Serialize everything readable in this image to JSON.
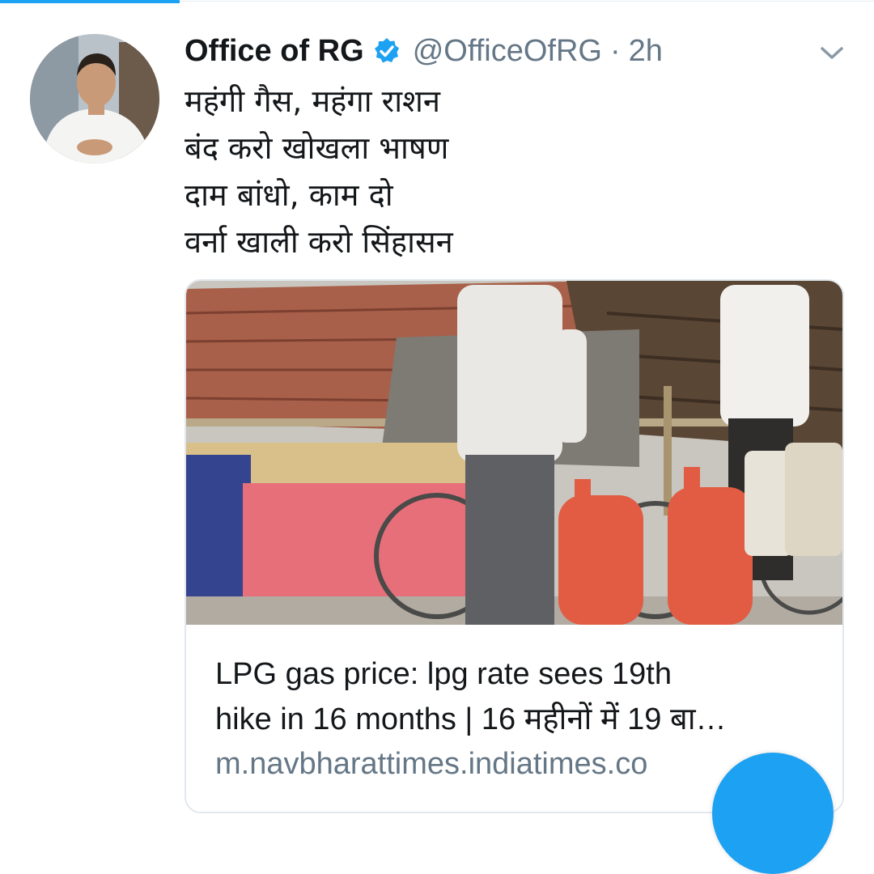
{
  "tweet": {
    "display_name": "Office of RG",
    "handle": "@OfficeOfRG",
    "separator": "·",
    "time": "2h",
    "verified": true,
    "lines": [
      "महंगी गैस, महंगा राशन",
      "बंद करो खोखला भाषण",
      "दाम बांधो, काम दो",
      "वर्ना खाली करो सिंहासन"
    ]
  },
  "card": {
    "title_line1": "LPG gas price: lpg rate sees 19th",
    "title_line2": "hike in 16 months | 16 महीनों में 19 बा…",
    "domain": "m.navbharattimes.indiatimes.co",
    "image_alt": "men pushing bicycles loaded with red LPG cylinders"
  },
  "colors": {
    "accent": "#1da1f2",
    "text": "#14171a",
    "secondary": "#657786",
    "border": "#e1e8ed"
  },
  "icons": {
    "verified": "verified-badge-icon",
    "caret": "chevron-down-icon",
    "fab": "compose-icon"
  }
}
